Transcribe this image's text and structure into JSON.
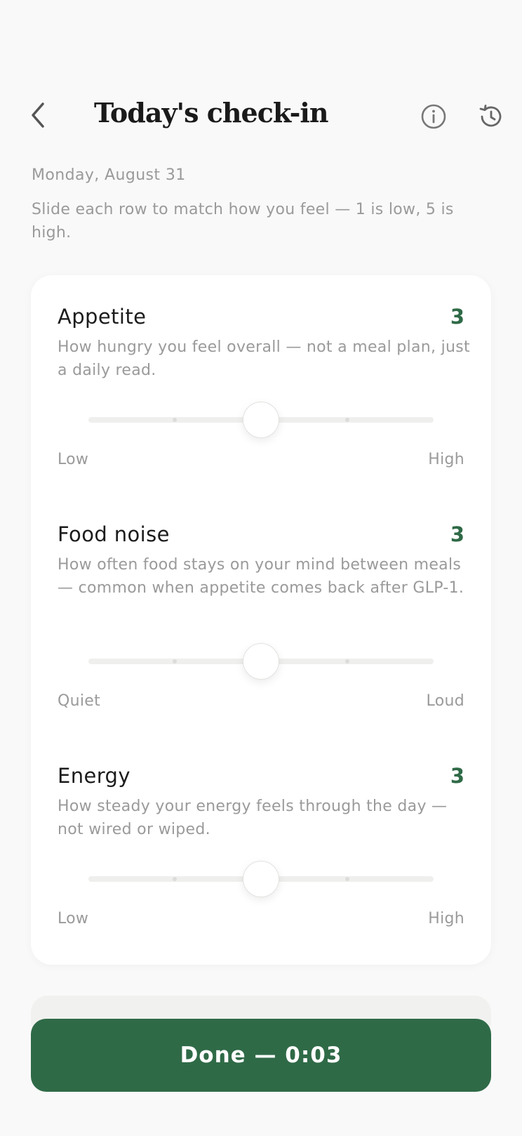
{
  "header": {
    "title": "Today's check-in",
    "back_icon": "chevron-left-icon",
    "info_icon": "info-circle-icon",
    "history_icon": "history-icon"
  },
  "date": "Monday, August 31",
  "intro": "Slide each row to match how you feel — 1 is low, 5 is high.",
  "metrics": [
    {
      "name": "Appetite",
      "value": "3",
      "description": "How hungry you feel overall — not a meal plan, just a daily read.",
      "low_label": "Low",
      "high_label": "High",
      "min": 1,
      "max": 5,
      "level": 3
    },
    {
      "name": "Food noise",
      "value": "3",
      "description": "How often food stays on your mind between meals — common when appetite comes back after GLP-1.",
      "low_label": "Quiet",
      "high_label": "Loud",
      "min": 1,
      "max": 5,
      "level": 3
    },
    {
      "name": "Energy",
      "value": "3",
      "description": "How steady your energy feels through the day — not wired or wiped.",
      "low_label": "Low",
      "high_label": "High",
      "min": 1,
      "max": 5,
      "level": 3
    }
  ],
  "done_button": "Done — 0:03",
  "colors": {
    "accent": "#2f6a47",
    "background": "#f9f9f9",
    "card": "#ffffff",
    "muted_text": "#9a9a9a"
  }
}
